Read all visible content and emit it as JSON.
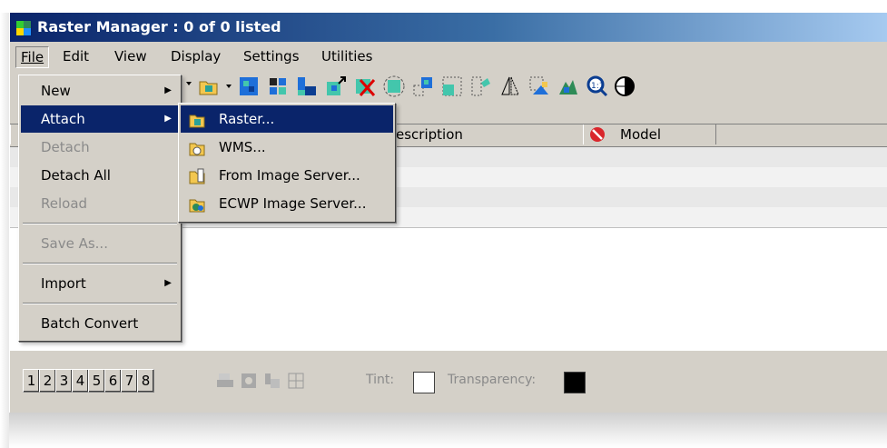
{
  "window": {
    "title": "Raster Manager : 0 of 0 listed"
  },
  "menubar": {
    "items": [
      {
        "label": "File",
        "accel": "F"
      },
      {
        "label": "Edit",
        "accel": "E"
      },
      {
        "label": "View",
        "accel": "V"
      },
      {
        "label": "Display",
        "accel": "D"
      },
      {
        "label": "Settings",
        "accel": "S"
      },
      {
        "label": "Utilities",
        "accel": "U"
      }
    ]
  },
  "file_menu": {
    "items": [
      {
        "label": "New",
        "submenu": true,
        "enabled": true
      },
      {
        "label": "Attach",
        "submenu": true,
        "enabled": true,
        "selected": true
      },
      {
        "label": "Detach",
        "enabled": false
      },
      {
        "label": "Detach All",
        "enabled": true
      },
      {
        "label": "Reload",
        "enabled": false
      },
      {
        "label": "Save As...",
        "enabled": false
      },
      {
        "label": "Import",
        "submenu": true,
        "enabled": true
      },
      {
        "label": "Batch Convert",
        "enabled": true
      }
    ]
  },
  "attach_submenu": {
    "items": [
      {
        "label": "Raster...",
        "icon": "raster-icon",
        "selected": true
      },
      {
        "label": "WMS...",
        "icon": "wms-icon"
      },
      {
        "label": "From Image Server...",
        "icon": "image-server-icon"
      },
      {
        "label": "ECWP Image Server...",
        "icon": "ecwp-server-icon"
      }
    ]
  },
  "list": {
    "columns": [
      "escription",
      "Model"
    ]
  },
  "statusbar": {
    "view_buttons": [
      "1",
      "2",
      "3",
      "4",
      "5",
      "6",
      "7",
      "8"
    ],
    "tint_label": "Tint:",
    "transparency_label": "Transparency:",
    "tint_color": "#ffffff",
    "transparency_color": "#000000"
  },
  "colors": {
    "titlebar": "#0a246a",
    "selection": "#0a246a",
    "face": "#d4d0c8"
  }
}
